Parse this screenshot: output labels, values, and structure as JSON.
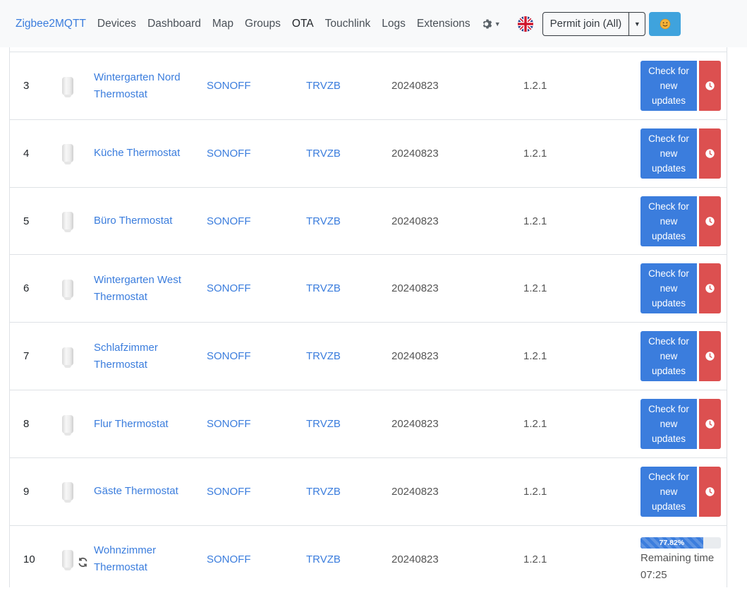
{
  "navbar": {
    "brand": "Zigbee2MQTT",
    "links": [
      "Devices",
      "Dashboard",
      "Map",
      "Groups",
      "OTA",
      "Touchlink",
      "Logs",
      "Extensions"
    ],
    "active_link": "OTA",
    "permit_join_label": "Permit join (All)",
    "smile_button_icon": "smile-emoji-icon",
    "language_icon": "uk-flag-icon"
  },
  "colors": {
    "link": "#3b7ddd",
    "check_button": "#3b7ddd",
    "schedule_button": "#dc5050",
    "navbar_bg": "#f8f9fa",
    "smile_button": "#3fa3dd"
  },
  "table": {
    "rows": [
      {
        "index": "3",
        "name": "Wintergarten Nord Thermostat",
        "vendor": "SONOFF",
        "model": "TRVZB",
        "date": "20240823",
        "version": "1.2.1",
        "check_label": "Check for new updates"
      },
      {
        "index": "4",
        "name": "Küche Thermostat",
        "vendor": "SONOFF",
        "model": "TRVZB",
        "date": "20240823",
        "version": "1.2.1",
        "check_label": "Check for new updates"
      },
      {
        "index": "5",
        "name": "Büro Thermostat",
        "vendor": "SONOFF",
        "model": "TRVZB",
        "date": "20240823",
        "version": "1.2.1",
        "check_label": "Check for new updates"
      },
      {
        "index": "6",
        "name": "Wintergarten West Thermostat",
        "vendor": "SONOFF",
        "model": "TRVZB",
        "date": "20240823",
        "version": "1.2.1",
        "check_label": "Check for new updates"
      },
      {
        "index": "7",
        "name": "Schlafzimmer Thermostat",
        "vendor": "SONOFF",
        "model": "TRVZB",
        "date": "20240823",
        "version": "1.2.1",
        "check_label": "Check for new updates"
      },
      {
        "index": "8",
        "name": "Flur Thermostat",
        "vendor": "SONOFF",
        "model": "TRVZB",
        "date": "20240823",
        "version": "1.2.1",
        "check_label": "Check for new updates"
      },
      {
        "index": "9",
        "name": "Gäste Thermostat",
        "vendor": "SONOFF",
        "model": "TRVZB",
        "date": "20240823",
        "version": "1.2.1",
        "check_label": "Check for new updates"
      }
    ],
    "updating_row": {
      "index": "10",
      "name": "Wohnzimmer Thermostat",
      "vendor": "SONOFF",
      "model": "TRVZB",
      "date": "20240823",
      "version": "1.2.1",
      "progress_percent": 77.82,
      "progress_label": "77.82%",
      "remaining_label": "Remaining time",
      "remaining_time": "07:25"
    }
  }
}
